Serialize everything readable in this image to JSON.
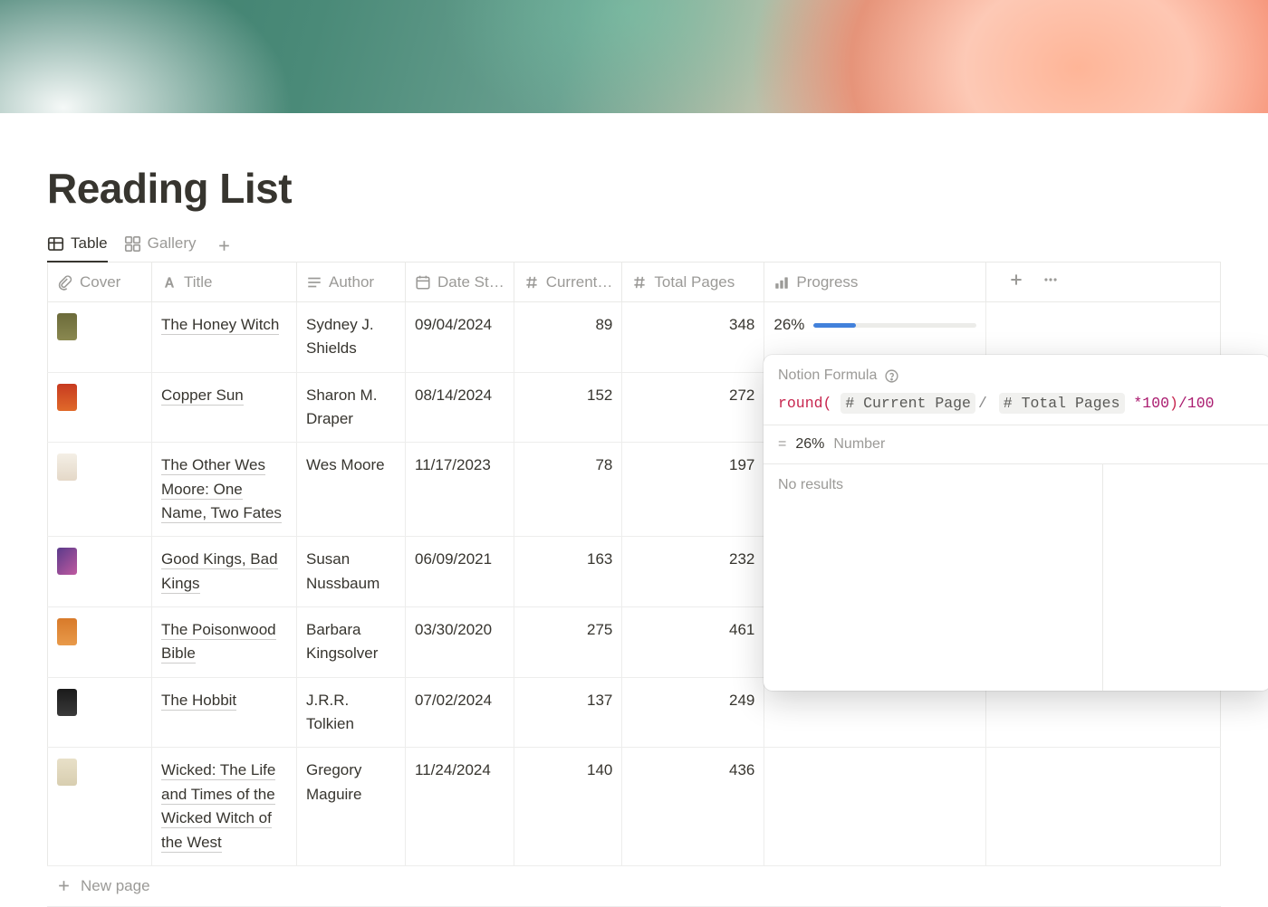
{
  "page_title": "Reading List",
  "tabs": {
    "table": "Table",
    "gallery": "Gallery"
  },
  "columns": {
    "cover": "Cover",
    "title": "Title",
    "author": "Author",
    "date": "Date St…",
    "current": "Current…",
    "total": "Total Pages",
    "progress": "Progress"
  },
  "rows": [
    {
      "title": "The Honey Witch",
      "author": "Sydney J. Shields",
      "date": "09/04/2024",
      "current": "89",
      "total": "348",
      "progress": "26%",
      "thumb_css": "linear-gradient(#6b6a3a,#8a8850)"
    },
    {
      "title": "Copper Sun",
      "author": "Sharon M. Draper",
      "date": "08/14/2024",
      "current": "152",
      "total": "272",
      "progress": "",
      "thumb_css": "linear-gradient(#c73a20,#e06a2a)"
    },
    {
      "title": "The Other Wes Moore: One Name, Two Fates",
      "author": "Wes Moore",
      "date": "11/17/2023",
      "current": "78",
      "total": "197",
      "progress": "",
      "thumb_css": "linear-gradient(#f4efe6,#e4d8c8)"
    },
    {
      "title": "Good Kings, Bad Kings",
      "author": "Susan Nussbaum",
      "date": "06/09/2021",
      "current": "163",
      "total": "232",
      "progress": "",
      "thumb_css": "linear-gradient(135deg,#5a3a8a,#c05aa0)"
    },
    {
      "title": "The Poisonwood Bible",
      "author": "Barbara Kingsolver",
      "date": "03/30/2020",
      "current": "275",
      "total": "461",
      "progress": "",
      "thumb_css": "linear-gradient(#d87a2a,#e89a4a)"
    },
    {
      "title": "The Hobbit",
      "author": "J.R.R. Tolkien",
      "date": "07/02/2024",
      "current": "137",
      "total": "249",
      "progress": "",
      "thumb_css": "linear-gradient(#1a1a1a,#3a3a3a)"
    },
    {
      "title": "Wicked: The Life and Times of the Wicked Witch of the West",
      "author": "Gregory Maguire",
      "date": "11/24/2024",
      "current": "140",
      "total": "436",
      "progress": "",
      "thumb_css": "linear-gradient(#e8e0c8,#d8ceb0)"
    }
  ],
  "new_page_label": "New page",
  "formula_popup": {
    "header": "Notion Formula",
    "fn": "round",
    "chip1": "# Current Page",
    "chip2": "# Total Pages",
    "star100": "*100",
    "tail": "/100",
    "result_eq": "=",
    "result_val": "26%",
    "result_type": "Number",
    "no_results": "No results"
  }
}
